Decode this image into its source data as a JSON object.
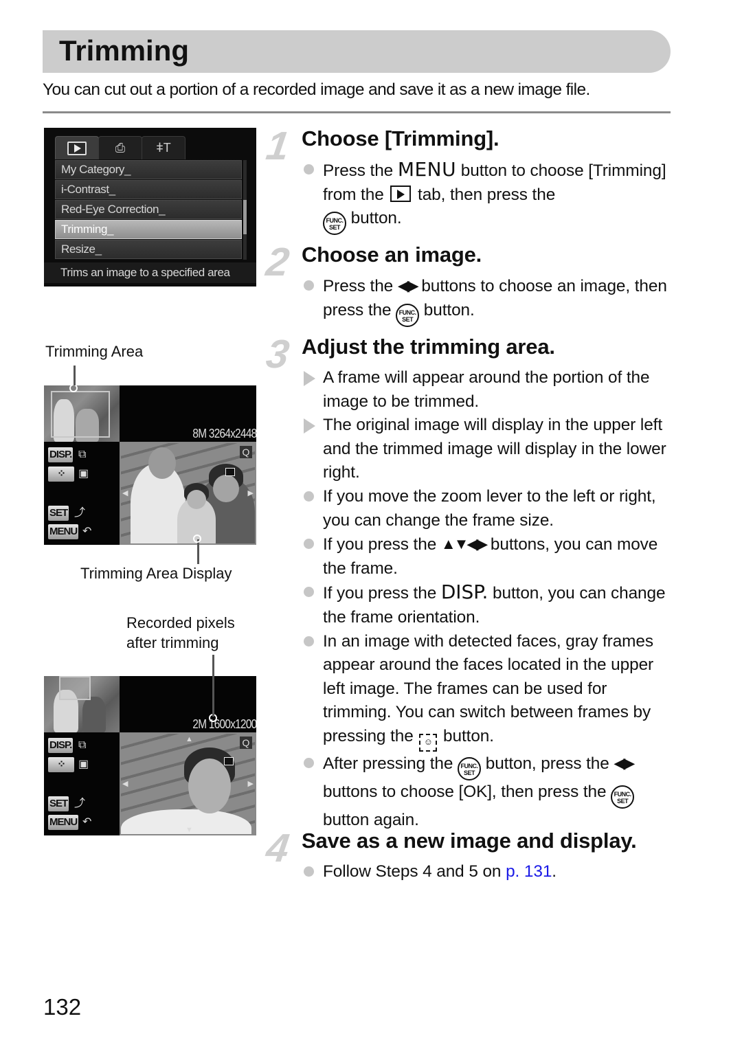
{
  "header": {
    "title": "Trimming",
    "intro": "You can cut out a portion of a recorded image and save it as a new image file."
  },
  "menu_screen": {
    "tabs": [
      {
        "icon": "playback-icon",
        "active": true
      },
      {
        "icon": "print-icon",
        "glyph": "⎙",
        "active": false
      },
      {
        "icon": "settings-tools-icon",
        "glyph": "ǂT",
        "active": false
      }
    ],
    "items": [
      {
        "label": "My Category_",
        "selected": false
      },
      {
        "label": "i-Contrast_",
        "selected": false
      },
      {
        "label": "Red-Eye Correction_",
        "selected": false
      },
      {
        "label": "Trimming_",
        "selected": true
      },
      {
        "label": "Resize_",
        "selected": false
      }
    ],
    "description": "Trims an image to a specified area"
  },
  "trim_screen_1": {
    "caption_top": "Trimming Area",
    "caption_bottom": "Trimming Area Display",
    "pixels": "8M 3264x2448",
    "controls": {
      "disp": "DISP.",
      "face": "⁘",
      "set": "SET",
      "menu": "MENU",
      "disp_glyph": "⧉",
      "face_glyph": "▣",
      "set_glyph": "⤴",
      "menu_glyph": "↶"
    }
  },
  "trim_screen_2": {
    "caption_line1": "Recorded pixels",
    "caption_line2": "after trimming",
    "pixels": "2M 1600x1200",
    "controls": {
      "disp": "DISP.",
      "face": "⁘",
      "set": "SET",
      "menu": "MENU",
      "disp_glyph": "⧉",
      "face_glyph": "▣",
      "set_glyph": "⤴",
      "menu_glyph": "↶"
    }
  },
  "steps": [
    {
      "number": "1",
      "title": "Choose [Trimming].",
      "bullets": [
        {
          "type": "dot",
          "parts": {
            "a": "Press the ",
            "menu": "MENU",
            "b": " button to choose [Trimming] from the ",
            "c": " tab, then press the ",
            "func_top": "FUNC.",
            "func_bottom": "SET",
            "d": " button."
          }
        }
      ]
    },
    {
      "number": "2",
      "title": "Choose an image.",
      "bullets": [
        {
          "type": "dot",
          "parts": {
            "a": "Press the ",
            "arrows": "◀▶",
            "b": " buttons to choose an image, then press the ",
            "func_top": "FUNC.",
            "func_bottom": "SET",
            "c": " button."
          }
        }
      ]
    },
    {
      "number": "3",
      "title": "Adjust the trimming area.",
      "bullets": [
        {
          "type": "triangle",
          "text": "A frame will appear around the portion of the image to be trimmed."
        },
        {
          "type": "triangle",
          "text": "The original image will display in the upper left and the trimmed image will display in the lower right."
        },
        {
          "type": "dot",
          "text": "If you move the zoom lever to the left or right, you can change the frame size."
        },
        {
          "type": "dot",
          "parts": {
            "a": "If you press the ",
            "arrows": "▲▼◀▶",
            "b": " buttons, you can move the frame."
          }
        },
        {
          "type": "dot",
          "parts": {
            "a": "If you press the ",
            "disp": "DISP.",
            "b": " button, you can change the frame orientation."
          }
        },
        {
          "type": "dot",
          "parts": {
            "a": "In an image with detected faces, gray frames appear around the faces located in the upper left image. The frames can be used for trimming. You can switch between frames by pressing the ",
            "face": "☺",
            "b": " button."
          }
        },
        {
          "type": "dot",
          "parts": {
            "a": "After pressing the ",
            "func_top": "FUNC.",
            "func_bottom": "SET",
            "b": " button, press the ",
            "arrows": "◀▶",
            "c": " buttons to choose [OK], then press the ",
            "d": " button again."
          }
        }
      ]
    },
    {
      "number": "4",
      "title": "Save as a new image and display.",
      "bullets": [
        {
          "type": "dot",
          "parts": {
            "a": "Follow Steps 4 and 5 on ",
            "link": "p. 131",
            "b": "."
          }
        }
      ]
    }
  ],
  "colors": {
    "title_bar": "#cccccc",
    "step_number": "#cfcfcf",
    "bullet": "#c6c6c6",
    "link": "#1a1ae6"
  },
  "page_number": "132"
}
